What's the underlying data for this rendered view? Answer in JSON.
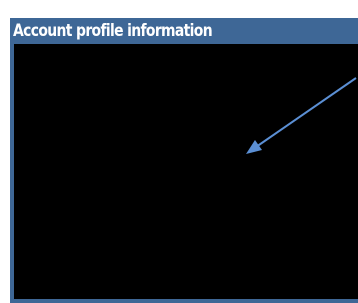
{
  "panel": {
    "title": "Account profile information"
  },
  "colors": {
    "panel_header": "#3e6796",
    "body": "#000000",
    "arrow": "#5b8fd4"
  },
  "annotation": {
    "icon": "arrow-icon"
  }
}
